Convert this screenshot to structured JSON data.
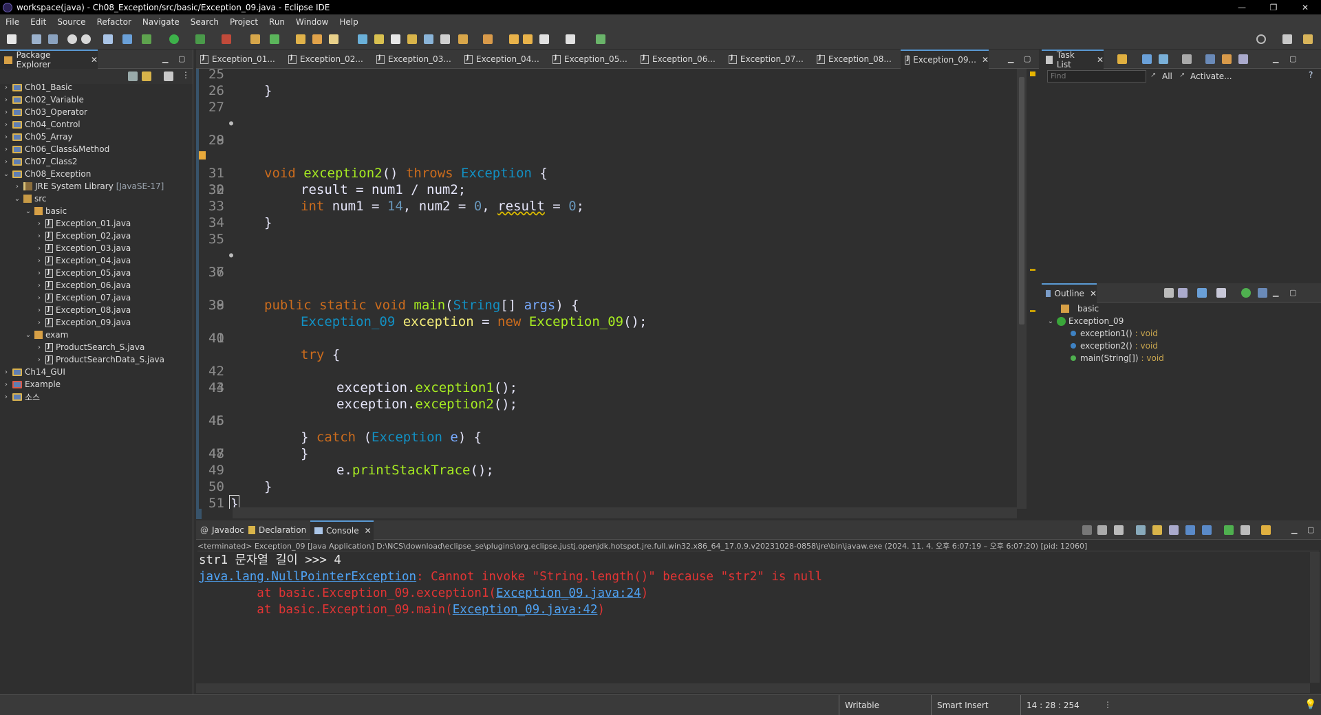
{
  "window": {
    "title": "workspace(java) - Ch08_Exception/src/basic/Exception_09.java - Eclipse IDE",
    "buttons": [
      "—",
      "❐",
      "✕"
    ]
  },
  "menu": [
    "File",
    "Edit",
    "Source",
    "Refactor",
    "Navigate",
    "Search",
    "Project",
    "Run",
    "Window",
    "Help"
  ],
  "package_explorer": {
    "tab_label": "Package Explorer",
    "projects_top": [
      "Ch01_Basic",
      "Ch02_Variable",
      "Ch03_Operator",
      "Ch04_Control",
      "Ch05_Array",
      "Ch06_Class&Method",
      "Ch07_Class2",
      "Ch08_Exception"
    ],
    "jre_label": "JRE System Library",
    "jre_version": "[JavaSE-17]",
    "src_label": "src",
    "basic_pkg": "basic",
    "basic_files": [
      "Exception_01.java",
      "Exception_02.java",
      "Exception_03.java",
      "Exception_04.java",
      "Exception_05.java",
      "Exception_06.java",
      "Exception_07.java",
      "Exception_08.java",
      "Exception_09.java"
    ],
    "exam_pkg": "exam",
    "exam_files": [
      "ProductSearch_S.java",
      "ProductSearchData_S.java"
    ],
    "projects_bottom": [
      "Ch14_GUI",
      "Example",
      "소스"
    ]
  },
  "editor": {
    "tabs": [
      "Exception_01...",
      "Exception_02...",
      "Exception_03...",
      "Exception_04...",
      "Exception_05...",
      "Exception_06...",
      "Exception_07...",
      "Exception_08...",
      "Exception_09..."
    ],
    "active_tab_index": 8,
    "line_numbers": [
      "25",
      "26",
      "27",
      "28",
      "29",
      "30",
      "31",
      "32",
      "33",
      "34",
      "35",
      "36",
      "37",
      "38",
      "39",
      "40",
      "41",
      "42",
      "43",
      "44",
      "45",
      "46",
      "47",
      "48",
      "49",
      "50",
      "51"
    ],
    "code": {
      "l26": "}",
      "l28_void": "void",
      "l28_name": "exception2",
      "l28_paren": "()",
      "l28_throws": "throws",
      "l28_type": "Exception",
      "l28_brace": "{",
      "l30_int": "int",
      "l30_a": "num1",
      "l30_eq1": "=",
      "l30_v1": "14",
      "l30_c1": ",",
      "l30_b": "num2",
      "l30_eq2": "=",
      "l30_v2": "0",
      "l30_c2": ",",
      "l30_c": "result",
      "l30_eq3": "=",
      "l30_v3": "0",
      "l30_semi": ";",
      "l32": "result = num1 / num2;",
      "l34": "}",
      "l36_public": "public",
      "l36_static": "static",
      "l36_void": "void",
      "l36_main": "main",
      "l36_open": "(",
      "l36_string": "String",
      "l36_arr": "[]",
      "l36_args": "args",
      "l36_close": ") {",
      "l38_type": "Exception_09",
      "l38_var": "exception",
      "l38_eq": "=",
      "l38_new": "new",
      "l38_ctor": "Exception_09",
      "l38_end": "();",
      "l40_try": "try",
      "l40_brace": "{",
      "l42_obj": "exception",
      "l42_dot": ".",
      "l42_m": "exception1",
      "l42_end": "();",
      "l43_obj": "exception",
      "l43_dot": ".",
      "l43_m": "exception2",
      "l43_end": "();",
      "l45_close": "}",
      "l45_catch": "catch",
      "l45_open": "(",
      "l45_type": "Exception",
      "l45_var": "e",
      "l45_end": ") {",
      "l47_obj": "e",
      "l47_dot": ".",
      "l47_m": "printStackTrace",
      "l47_end": "();",
      "l48": "}",
      "l50": "}",
      "l51": "}"
    }
  },
  "task_list": {
    "tab_label": "Task List",
    "find_placeholder": "Find",
    "all_label": "All",
    "activate_label": "Activate..."
  },
  "outline": {
    "tab_label": "Outline",
    "package": "basic",
    "class": "Exception_09",
    "members": [
      {
        "name": "exception1()",
        "type": ": void"
      },
      {
        "name": "exception2()",
        "type": ": void"
      },
      {
        "name": "main(String[])",
        "type": ": void"
      }
    ]
  },
  "bottom_tabs": [
    "Javadoc",
    "Declaration",
    "Console"
  ],
  "console": {
    "header": "<terminated> Exception_09 [Java Application] D:\\NCS\\download\\eclipse_se\\plugins\\org.eclipse.justj.openjdk.hotspot.jre.full.win32.x86_64_17.0.9.v20231028-0858\\jre\\bin\\javaw.exe  (2024. 11. 4. 오후 6:07:19 – 오후 6:07:20) [pid: 12060]",
    "line1": "str1 문자열 길이 >>> 4",
    "exception_link": "java.lang.NullPointerException",
    "exception_msg": ": Cannot invoke \"String.length()\" because \"str2\" is null",
    "trace1_prefix": "        at basic.Exception_09.exception1(",
    "trace1_link": "Exception_09.java:24",
    "trace1_suffix": ")",
    "trace2_prefix": "        at basic.Exception_09.main(",
    "trace2_link": "Exception_09.java:42",
    "trace2_suffix": ")"
  },
  "status": {
    "writable": "Writable",
    "insert_mode": "Smart Insert",
    "position": "14 : 28 : 254"
  }
}
